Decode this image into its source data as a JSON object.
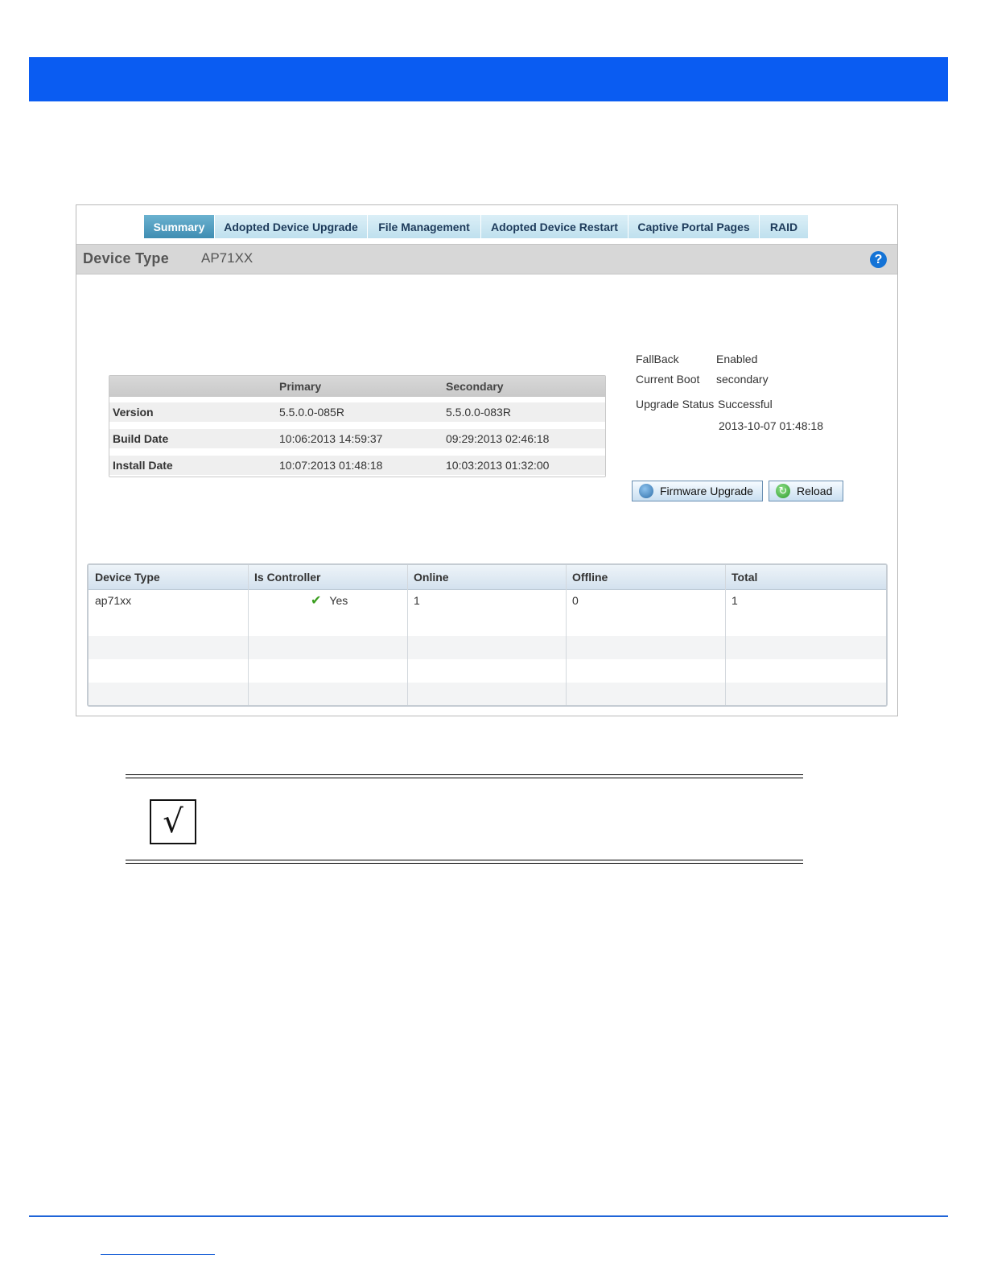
{
  "tabs": [
    {
      "label": "Summary",
      "active": true
    },
    {
      "label": "Adopted Device Upgrade",
      "active": false
    },
    {
      "label": "File Management",
      "active": false
    },
    {
      "label": "Adopted Device Restart",
      "active": false
    },
    {
      "label": "Captive Portal Pages",
      "active": false
    },
    {
      "label": "RAID",
      "active": false
    }
  ],
  "device_bar": {
    "label": "Device Type",
    "value": "AP71XX",
    "help_icon": "?"
  },
  "firmware_table": {
    "headers": [
      "",
      "Primary",
      "Secondary"
    ],
    "rows": [
      [
        "Version",
        "5.5.0.0-085R",
        "5.5.0.0-083R"
      ],
      [
        "Build Date",
        "10:06:2013 14:59:37",
        "09:29:2013 02:46:18"
      ],
      [
        "Install Date",
        "10:07:2013 01:48:18",
        "10:03:2013 01:32:00"
      ]
    ]
  },
  "status": {
    "fallback_label": "FallBack",
    "fallback_value": "Enabled",
    "current_boot_label": "Current Boot",
    "current_boot_value": "secondary",
    "upgrade_status_label": "Upgrade Status",
    "upgrade_status_value": "Successful",
    "upgrade_time": "2013-10-07 01:48:18"
  },
  "buttons": {
    "firmware_upgrade": "Firmware Upgrade",
    "reload": "Reload"
  },
  "device_grid": {
    "headers": [
      "Device Type",
      "Is Controller",
      "Online",
      "Offline",
      "Total"
    ],
    "rows": [
      [
        "ap71xx",
        "Yes",
        "1",
        "0",
        "1"
      ]
    ]
  },
  "note_icon": "√",
  "colors": {
    "banner": "#0a5cf2",
    "active_tab": "#3f8db2",
    "footer_rule": "#1f64d8"
  }
}
